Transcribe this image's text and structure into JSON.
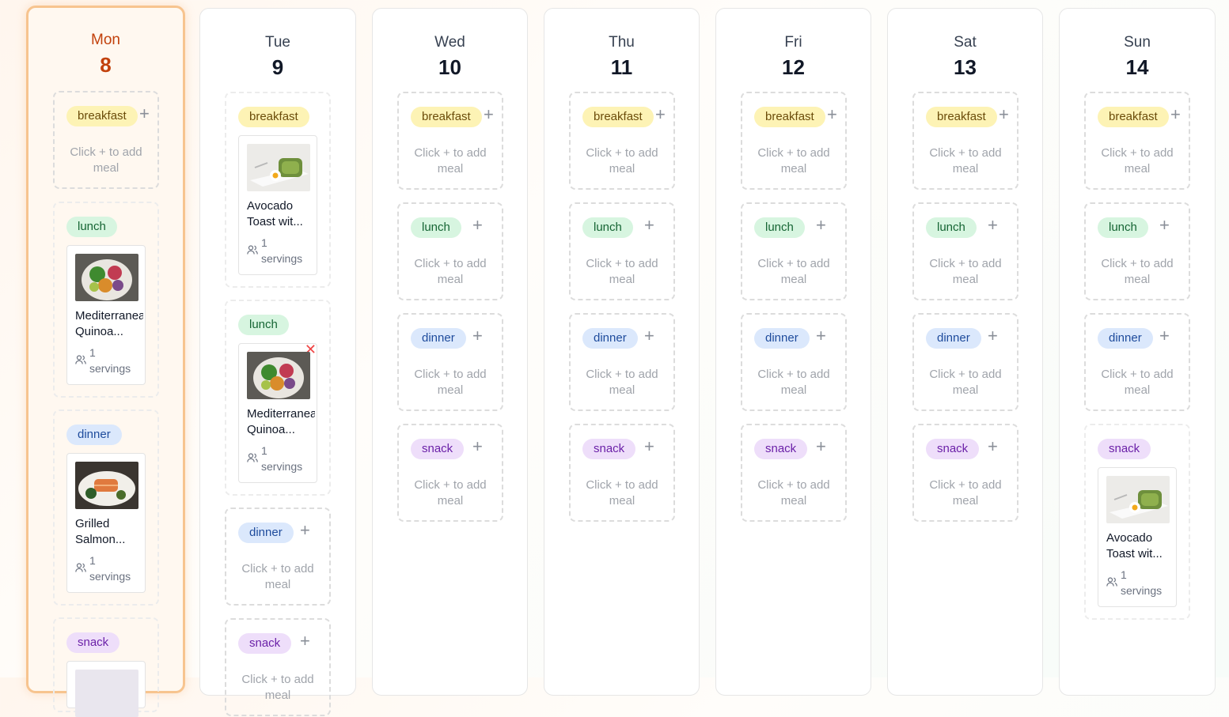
{
  "days": [
    {
      "name": "Mon",
      "num": "8"
    },
    {
      "name": "Tue",
      "num": "9"
    },
    {
      "name": "Wed",
      "num": "10"
    },
    {
      "name": "Thu",
      "num": "11"
    },
    {
      "name": "Fri",
      "num": "12"
    },
    {
      "name": "Sat",
      "num": "13"
    },
    {
      "name": "Sun",
      "num": "14"
    }
  ],
  "meal_types": {
    "breakfast": "breakfast",
    "lunch": "lunch",
    "dinner": "dinner",
    "snack": "snack"
  },
  "empty_hint": "Click + to add meal",
  "plus": "+",
  "remove": "✕",
  "recipes": {
    "avocado": {
      "title_l1": "Avocado",
      "title_l2": "Toast wit...",
      "serv_num": "1",
      "serv_word": "servings"
    },
    "quinoa": {
      "title_l1": "Mediterranean",
      "title_l2": "Quinoa...",
      "serv_num": "1",
      "serv_word": "servings"
    },
    "salmon": {
      "title_l1": "Grilled",
      "title_l2": "Salmon...",
      "serv_num": "1",
      "serv_word": "servings"
    }
  },
  "colors": {
    "today_border": "#f7c48f",
    "today_text": "#c2410c",
    "remove": "#ef4444"
  }
}
